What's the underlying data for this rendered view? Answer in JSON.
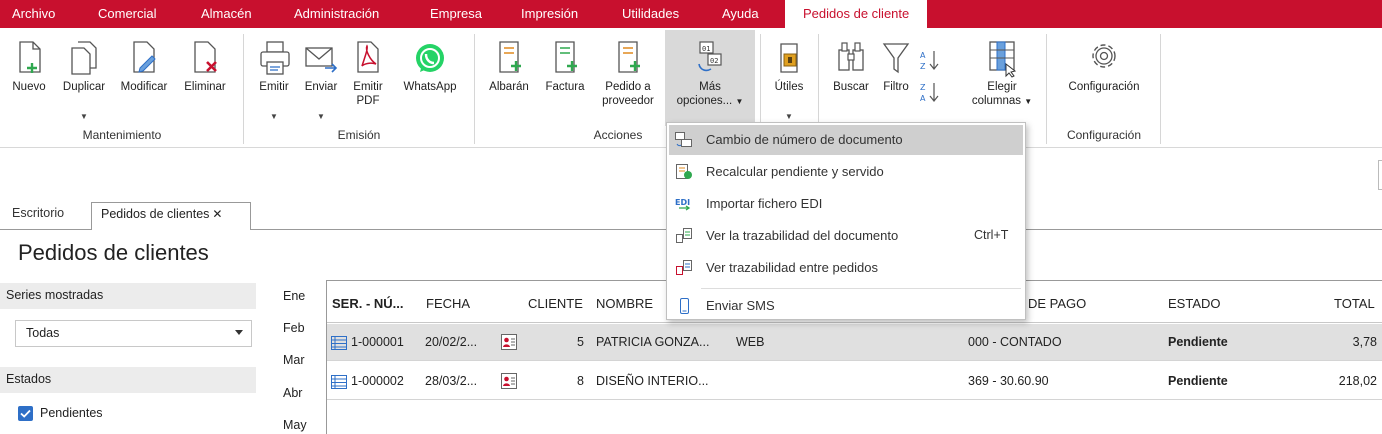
{
  "menubar": {
    "items": [
      "Archivo",
      "Comercial",
      "Almacén",
      "Administración",
      "Empresa",
      "Impresión",
      "Utilidades",
      "Ayuda"
    ],
    "active_tab": "Pedidos de cliente"
  },
  "ribbon": {
    "mantenimiento": {
      "group_label": "Mantenimiento",
      "nuevo": "Nuevo",
      "duplicar": "Duplicar",
      "modificar": "Modificar",
      "eliminar": "Eliminar"
    },
    "emision": {
      "group_label": "Emisión",
      "emitir": "Emitir",
      "enviar": "Enviar",
      "emitir_pdf_1": "Emitir",
      "emitir_pdf_2": "PDF",
      "whatsapp": "WhatsApp"
    },
    "acciones": {
      "group_label": "Acciones",
      "albaran": "Albarán",
      "factura": "Factura",
      "pedido_proveedor_1": "Pedido a",
      "pedido_proveedor_2": "proveedor",
      "mas_opciones_1": "Más",
      "mas_opciones_2": "opciones..."
    },
    "utiles": "Útiles",
    "buscar": "Buscar",
    "filtro": "Filtro",
    "elegir_columnas_1": "Elegir",
    "elegir_columnas_2": "columnas",
    "configuracion": {
      "group_label": "Configuración",
      "button": "Configuración"
    }
  },
  "tabs": {
    "escritorio": "Escritorio",
    "pedidos": "Pedidos de clientes",
    "close_glyph": "✕"
  },
  "page_title": "Pedidos de clientes",
  "filters": {
    "series_header": "Series mostradas",
    "series_value": "Todas",
    "estados_header": "Estados",
    "estado_pendientes": "Pendientes"
  },
  "months": [
    "Ene",
    "Feb",
    "Mar",
    "Abr",
    "May"
  ],
  "table": {
    "headers": {
      "ser": "SER. - NÚ...",
      "fecha": "FECHA",
      "cliente": "CLIENTE",
      "nombre": "NOMBRE",
      "pago": "DE PAGO",
      "estado": "ESTADO",
      "total": "TOTAL"
    },
    "rows": [
      {
        "num": "1-000001",
        "fecha": "20/02/2...",
        "cliente": "5",
        "nombre": "PATRICIA GONZA...",
        "extra": "WEB",
        "pago": "000 - CONTADO",
        "estado": "Pendiente",
        "total": "3,78"
      },
      {
        "num": "1-000002",
        "fecha": "28/03/2...",
        "cliente": "8",
        "nombre": "DISEÑO INTERIO...",
        "extra": "",
        "pago": "369 - 30.60.90",
        "estado": "Pendiente",
        "total": "218,02"
      }
    ]
  },
  "dropdown": {
    "items": [
      {
        "label": "Cambio de número de documento",
        "shortcut": ""
      },
      {
        "label": "Recalcular pendiente y servido",
        "shortcut": ""
      },
      {
        "label": "Importar fichero EDI",
        "shortcut": ""
      },
      {
        "label": "Ver la trazabilidad del documento",
        "shortcut": "Ctrl+T"
      },
      {
        "label": "Ver trazabilidad entre pedidos",
        "shortcut": ""
      },
      {
        "label": "Enviar SMS",
        "shortcut": ""
      }
    ]
  },
  "colors": {
    "brand_red": "#c8102e",
    "accent_green": "#2fa84f",
    "accent_blue": "#2e6fc7",
    "whatsapp_green": "#25d366"
  }
}
